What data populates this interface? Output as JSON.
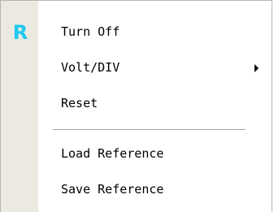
{
  "menu": {
    "items": [
      {
        "label": "Turn Off",
        "icon": "r-icon",
        "icon_text": "R"
      },
      {
        "label": "Volt/DIV",
        "submenu": true
      },
      {
        "label": "Reset"
      },
      {
        "label": "Load Reference"
      },
      {
        "label": "Save Reference"
      }
    ]
  },
  "colors": {
    "gutter": "#ebe9e0",
    "icon_accent": "#1ec8f0",
    "border": "#b4b4b4"
  }
}
